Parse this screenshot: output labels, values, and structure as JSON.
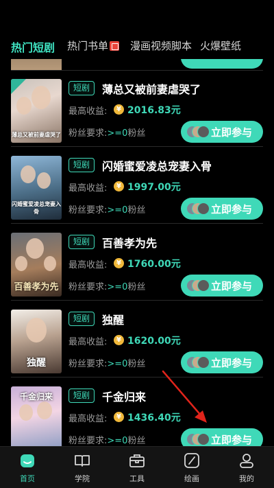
{
  "tabs": [
    {
      "label": "热门短剧",
      "active": true
    },
    {
      "label": "热门书单",
      "active": false
    },
    {
      "label": "漫画视频脚本",
      "active": false
    },
    {
      "label": "火爆壁纸",
      "active": false
    }
  ],
  "cards": [
    {
      "tag": "短剧",
      "title": "薄总又被前妻虐哭了",
      "earn_label": "最高收益:",
      "coin_symbol": "¥",
      "earn": "2016.83元",
      "fans_label": "粉丝要求:",
      "fans_value": ">=0",
      "fans_unit": "粉丝",
      "join": "立即参与",
      "thumb_text": "薄总又被前妻虐哭了"
    },
    {
      "tag": "短剧",
      "title": "闪婚蜜爱凌总宠妻入骨",
      "earn_label": "最高收益:",
      "coin_symbol": "¥",
      "earn": "1997.00元",
      "fans_label": "粉丝要求:",
      "fans_value": ">=0",
      "fans_unit": "粉丝",
      "join": "立即参与",
      "thumb_text": "闪婚蜜爱凌总宠妻入骨"
    },
    {
      "tag": "短剧",
      "title": "百善孝为先",
      "earn_label": "最高收益:",
      "coin_symbol": "¥",
      "earn": "1760.00元",
      "fans_label": "粉丝要求:",
      "fans_value": ">=0",
      "fans_unit": "粉丝",
      "join": "立即参与",
      "thumb_text": "百善孝为先"
    },
    {
      "tag": "短剧",
      "title": "独醒",
      "earn_label": "最高收益:",
      "coin_symbol": "¥",
      "earn": "1620.00元",
      "fans_label": "粉丝要求:",
      "fans_value": ">=0",
      "fans_unit": "粉丝",
      "join": "立即参与",
      "thumb_text": "独醒"
    },
    {
      "tag": "短剧",
      "title": "千金归来",
      "earn_label": "最高收益:",
      "coin_symbol": "¥",
      "earn": "1436.40元",
      "fans_label": "粉丝要求:",
      "fans_value": ">=0",
      "fans_unit": "粉丝",
      "join": "立即参与",
      "thumb_text": "千金归来"
    }
  ],
  "nav": [
    {
      "label": "首页",
      "icon": "home-icon",
      "active": true
    },
    {
      "label": "学院",
      "icon": "book-icon",
      "active": false
    },
    {
      "label": "工具",
      "icon": "toolbox-icon",
      "active": false
    },
    {
      "label": "绘画",
      "icon": "pen-icon",
      "active": false
    },
    {
      "label": "我的",
      "icon": "profile-icon",
      "active": false
    }
  ],
  "colors": {
    "accent": "#3fd9b8",
    "background": "#000000",
    "coin": "#f0b83a",
    "annotation_arrow": "#e0241b"
  }
}
